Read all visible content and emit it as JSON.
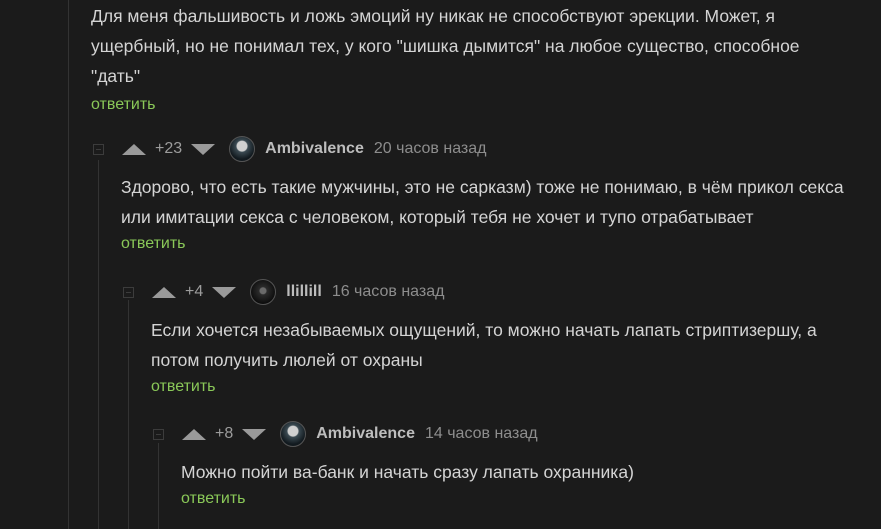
{
  "top_comment": {
    "text": "Для меня фальшивость и ложь эмоций ну никак не способствуют эрекции. Может, я ущербный, но не понимал тех, у кого \"шишка дымится\" на любое существо, способное \"дать\"",
    "reply_label": "ответить"
  },
  "comments": [
    {
      "rating": "+23",
      "author": "Ambivalence",
      "time": "20 часов назад",
      "text": "Здорово, что есть такие мужчины, это не сарказм) тоже не понимаю, в чём прикол секса или имитации секса с человеком, который тебя не хочет и тупо отрабатывает",
      "reply_label": "ответить"
    },
    {
      "rating": "+4",
      "author": "llillill",
      "time": "16 часов назад",
      "text": "Если хочется незабываемых ощущений, то можно начать лапать стриптизершу, а потом получить люлей от охраны",
      "reply_label": "ответить"
    },
    {
      "rating": "+8",
      "author": "Ambivalence",
      "time": "14 часов назад",
      "text": "Можно пойти ва-банк и начать сразу лапать охранника)",
      "reply_label": "ответить"
    }
  ],
  "icons": {
    "upvote": "arrow-up-icon",
    "downvote": "arrow-down-icon",
    "collapse": "collapse-icon"
  },
  "colors": {
    "background": "#1b1b1b",
    "reply_link": "#8ac858",
    "text": "#d4d4d4"
  }
}
